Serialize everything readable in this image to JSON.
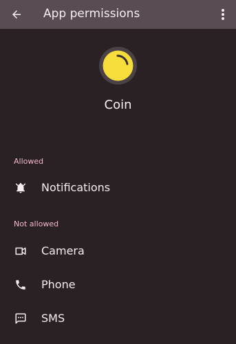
{
  "header": {
    "title": "App permissions",
    "back_icon": "arrow-back-icon",
    "menu_icon": "more-vert-icon"
  },
  "app": {
    "name": "Coin",
    "icon": "coin-app-icon"
  },
  "sections": {
    "allowed": {
      "label": "Allowed",
      "items": [
        {
          "label": "Notifications",
          "icon": "bell-icon"
        }
      ]
    },
    "not_allowed": {
      "label": "Not allowed",
      "items": [
        {
          "label": "Camera",
          "icon": "camera-icon"
        },
        {
          "label": "Phone",
          "icon": "phone-icon"
        },
        {
          "label": "SMS",
          "icon": "sms-icon"
        }
      ]
    }
  },
  "colors": {
    "background": "#2a2124",
    "toolbar": "#594c52",
    "section_label": "#f5b7cf",
    "coin_yellow": "#f6dd3b"
  }
}
